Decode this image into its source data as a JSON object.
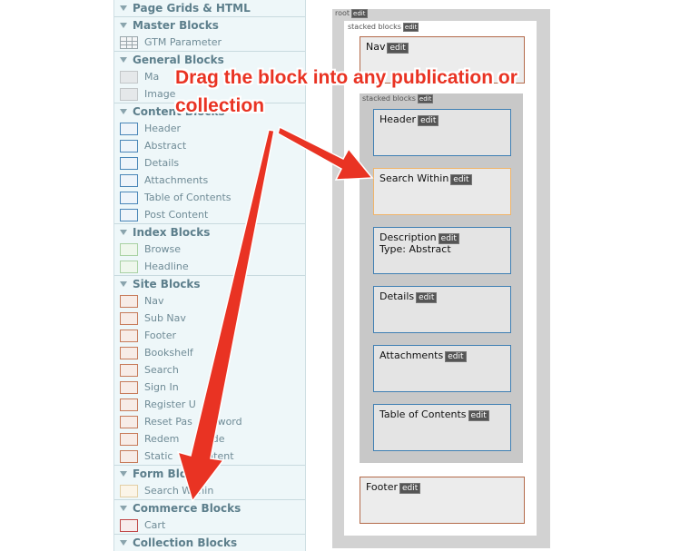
{
  "palette": {
    "sections": [
      {
        "title": "Page Grids & HTML",
        "items": []
      },
      {
        "title": "Master Blocks",
        "items": [
          {
            "label": "GTM Parameter",
            "swatch": "grid"
          }
        ]
      },
      {
        "title": "General Blocks",
        "items": [
          {
            "label": "Ma",
            "swatch": "gray"
          },
          {
            "label": "Image",
            "swatch": "gray"
          }
        ]
      },
      {
        "title": "Content Blocks",
        "items": [
          {
            "label": "Header",
            "swatch": "blue"
          },
          {
            "label": "Abstract",
            "swatch": "blue"
          },
          {
            "label": "Details",
            "swatch": "blue"
          },
          {
            "label": "Attachments",
            "swatch": "blue"
          },
          {
            "label": "Table of Contents",
            "swatch": "blue"
          },
          {
            "label": "Post Content",
            "swatch": "blue"
          }
        ]
      },
      {
        "title": "Index Blocks",
        "items": [
          {
            "label": "Browse",
            "swatch": "green"
          },
          {
            "label": "Headline",
            "swatch": "green"
          }
        ]
      },
      {
        "title": "Site Blocks",
        "items": [
          {
            "label": "Nav",
            "swatch": "brown"
          },
          {
            "label": "Sub Nav",
            "swatch": "brown"
          },
          {
            "label": "Footer",
            "swatch": "brown"
          },
          {
            "label": "Bookshelf",
            "swatch": "brown"
          },
          {
            "label": "Search",
            "swatch": "brown"
          },
          {
            "label": "Sign In",
            "swatch": "brown"
          },
          {
            "label": "Register U",
            "swatch": "brown"
          },
          {
            "label": "Reset Pas",
            "swatch": "brown"
          },
          {
            "label": "Redem",
            "swatch": "brown"
          },
          {
            "label": "Static",
            "swatch": "brown"
          }
        ]
      },
      {
        "title": "Form Blocks",
        "items": [
          {
            "label": "Search Within",
            "swatch": "tan"
          }
        ]
      },
      {
        "title": "Commerce Blocks",
        "items": [
          {
            "label": "Cart",
            "swatch": "red"
          }
        ]
      },
      {
        "title": "Collection Blocks",
        "items": []
      }
    ],
    "extra_fragments": {
      "reset_tail": "sword",
      "redem_tail": "Code",
      "static_tail": "ontent"
    }
  },
  "tree": {
    "root_label": "root",
    "edit_label": "edit",
    "stacked_label": "stacked blocks",
    "nav": "Nav",
    "footer": "Footer",
    "inner_blocks": [
      {
        "label": "Header",
        "sub": "",
        "style": "blue"
      },
      {
        "label": "Search Within",
        "sub": "",
        "style": "orange"
      },
      {
        "label": "Description",
        "sub": "Type: Abstract",
        "style": "blue"
      },
      {
        "label": "Details",
        "sub": "",
        "style": "blue"
      },
      {
        "label": "Attachments",
        "sub": "",
        "style": "blue"
      },
      {
        "label": "Table of Contents",
        "sub": "",
        "style": "blue"
      }
    ]
  },
  "annotation": {
    "line1": "Drag the block into any publication or",
    "line2": "collection",
    "color": "#e93323"
  }
}
